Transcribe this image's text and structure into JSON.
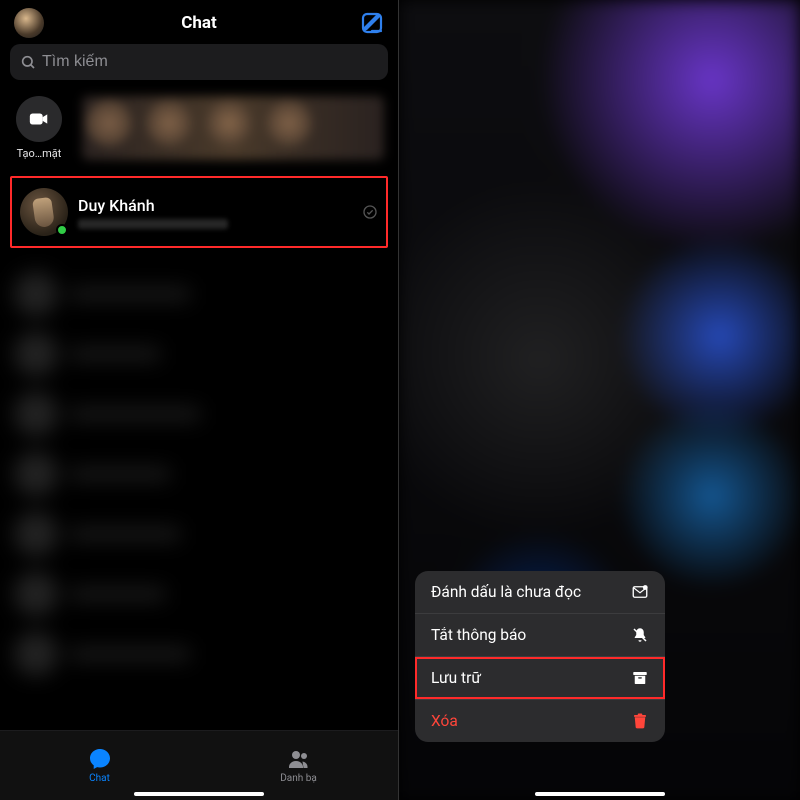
{
  "header": {
    "title": "Chat"
  },
  "search": {
    "placeholder": "Tìm kiếm"
  },
  "createRoom": {
    "label": "Tạo…mặt"
  },
  "highlightedConversation": {
    "name": "Duy Khánh"
  },
  "bottomNav": {
    "items": [
      {
        "label": "Chat",
        "icon": "chat-icon",
        "active": true
      },
      {
        "label": "Danh bạ",
        "icon": "people-icon",
        "active": false
      }
    ]
  },
  "contextMenu": {
    "items": [
      {
        "label": "Đánh dấu là chưa đọc",
        "icon": "unread-icon",
        "highlighted": false,
        "destructive": false
      },
      {
        "label": "Tắt thông báo",
        "icon": "mute-icon",
        "highlighted": false,
        "destructive": false
      },
      {
        "label": "Lưu trữ",
        "icon": "archive-icon",
        "highlighted": true,
        "destructive": false
      },
      {
        "label": "Xóa",
        "icon": "trash-icon",
        "highlighted": false,
        "destructive": true
      }
    ]
  }
}
